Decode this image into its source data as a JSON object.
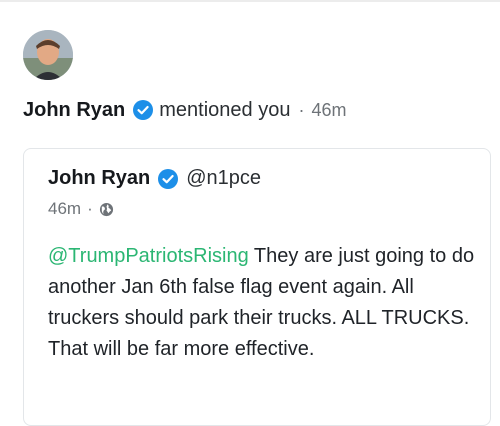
{
  "notification": {
    "author_name": "John Ryan",
    "action_text": "mentioned you",
    "separator": "·",
    "time": "46m"
  },
  "post": {
    "author_name": "John Ryan",
    "handle": "@n1pce",
    "time": "46m",
    "separator": "·",
    "visibility_icon": "globe-icon",
    "mention": "@TrumpPatriotsRising",
    "text": " They are just going to do another Jan 6th false flag event again. All truckers should park their trucks. ALL TRUCKS. That will be far more effective."
  },
  "colors": {
    "verified": "#1d8fe8",
    "mention": "#2bb673",
    "muted": "#6e7378"
  }
}
